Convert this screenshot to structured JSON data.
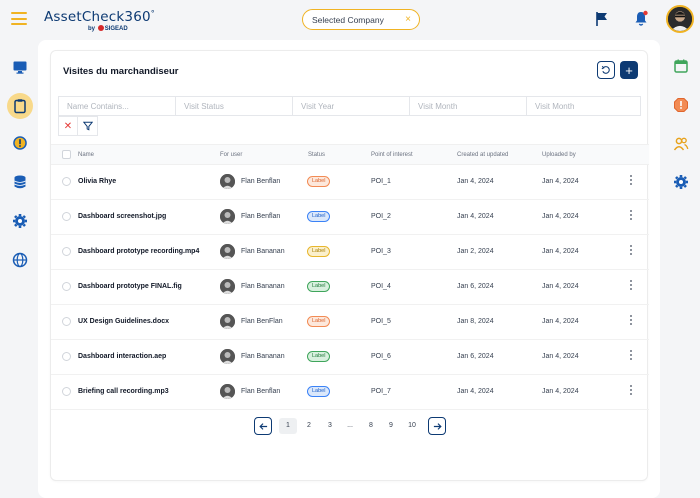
{
  "header": {
    "logo_main": "AssetCheck360",
    "logo_degree": "°",
    "logo_by": "by",
    "logo_brand": "SIGEAD",
    "company_label": "Selected Company",
    "company_clear": "×"
  },
  "page": {
    "title": "Visites du marchandiseur",
    "add_label": "+"
  },
  "filters": {
    "name_placeholder": "Name Contains...",
    "status_placeholder": "Visit Status",
    "year_placeholder": "Visit Year",
    "month_placeholder": "Visit Month",
    "month2_placeholder": "Visit Month",
    "clear_label": "✕"
  },
  "table": {
    "columns": [
      "Name",
      "For user",
      "Status",
      "Point of interest",
      "Created at updated",
      "Uploaded by"
    ],
    "rows": [
      {
        "name": "Olivia Rhye",
        "user": "Flan Benflan",
        "status": "Label",
        "status_color": "orange",
        "poi": "POI_1",
        "created": "Jan 4, 2024",
        "uploaded": "Jan 4, 2024"
      },
      {
        "name": "Dashboard screenshot.jpg",
        "user": "Flan Benflan",
        "status": "Label",
        "status_color": "blue",
        "poi": "POI_2",
        "created": "Jan 4, 2024",
        "uploaded": "Jan 4, 2024"
      },
      {
        "name": "Dashboard prototype recording.mp4",
        "user": "Flan Bananan",
        "status": "Label",
        "status_color": "yellow",
        "poi": "POI_3",
        "created": "Jan 2, 2024",
        "uploaded": "Jan 4, 2024"
      },
      {
        "name": "Dashboard prototype FINAL.fig",
        "user": "Flan Bananan",
        "status": "Label",
        "status_color": "green",
        "poi": "POI_4",
        "created": "Jan 6, 2024",
        "uploaded": "Jan 4, 2024"
      },
      {
        "name": "UX Design Guidelines.docx",
        "user": "Flan BenFlan",
        "status": "Label",
        "status_color": "orange",
        "poi": "POI_5",
        "created": "Jan 8, 2024",
        "uploaded": "Jan 4, 2024"
      },
      {
        "name": "Dashboard interaction.aep",
        "user": "Flan Bananan",
        "status": "Label",
        "status_color": "green",
        "poi": "POI_6",
        "created": "Jan 6, 2024",
        "uploaded": "Jan 4, 2024"
      },
      {
        "name": "Briefing call recording.mp3",
        "user": "Flan Benflan",
        "status": "Label",
        "status_color": "blue",
        "poi": "POI_7",
        "created": "Jan 4, 2024",
        "uploaded": "Jan 4, 2024"
      }
    ]
  },
  "pagination": {
    "pages": [
      "1",
      "2",
      "3",
      "...",
      "8",
      "9",
      "10"
    ],
    "current": "1"
  },
  "colors": {
    "accent": "#f0b323",
    "primary": "#0d3a73",
    "orange": "#f28b54",
    "blue": "#3b82f6",
    "yellow": "#e8b62c",
    "green": "#3fa55b"
  },
  "icons": {
    "left_sidebar": [
      "monitor-icon",
      "clipboard-icon",
      "alert-icon",
      "database-icon",
      "gear-icon",
      "globe-icon"
    ],
    "right_sidebar": [
      "calendar-icon",
      "alert-octagon-icon",
      "users-icon",
      "gear-icon"
    ]
  }
}
